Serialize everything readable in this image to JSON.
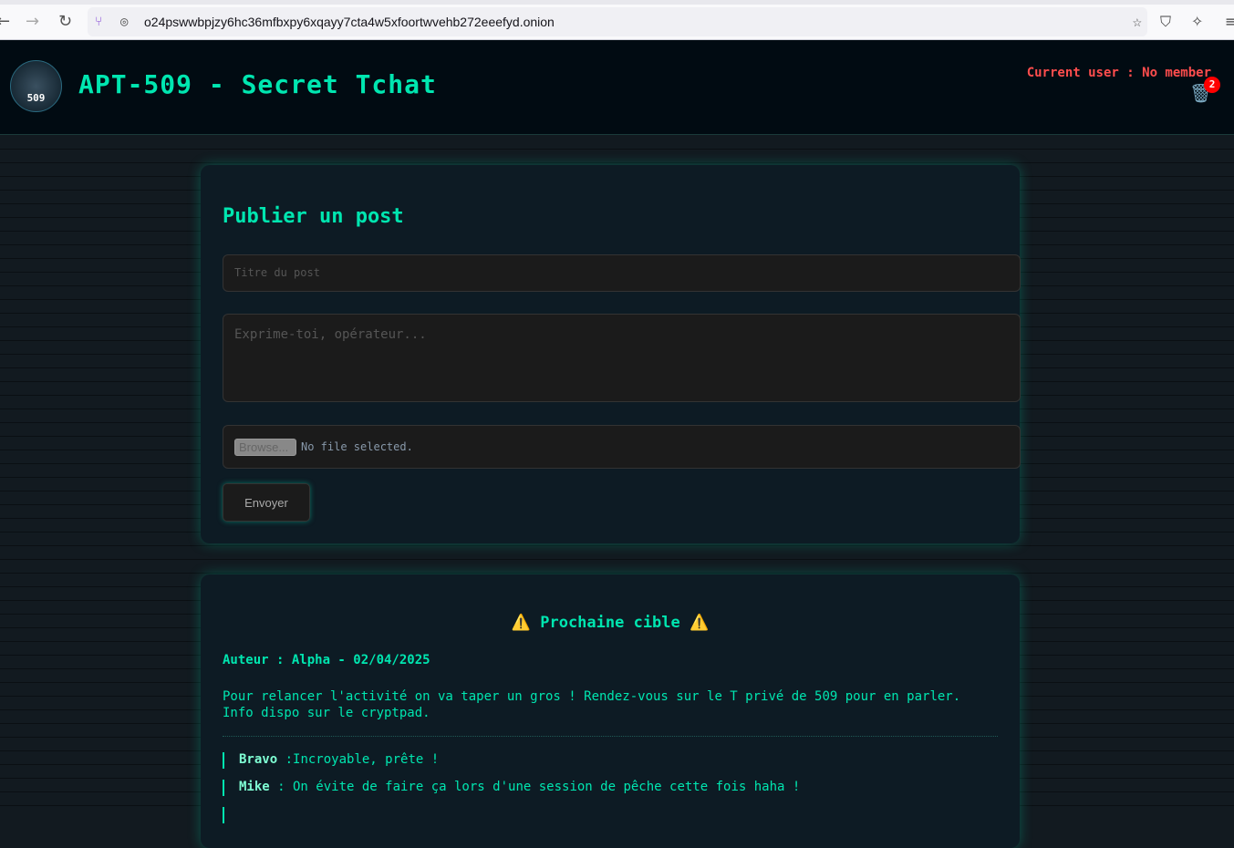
{
  "browser": {
    "url": "o24pswwbpjzy6hc36mfbxpy6xqayy7cta4w5xfoortwvehb272eeefyd.onion"
  },
  "header": {
    "logo_text": "509",
    "title": "APT-509 - Secret Tchat",
    "current_user": "Current user : No member",
    "trash_count": "2"
  },
  "form": {
    "heading": "Publier un post",
    "title_placeholder": "Titre du post",
    "body_placeholder": "Exprime-toi, opérateur...",
    "browse_label": "Browse...",
    "file_status": "No file selected.",
    "submit_label": "Envoyer"
  },
  "post": {
    "title": "Prochaine cible",
    "warning_icon": "⚠️",
    "author": "Auteur : Alpha - 02/04/2025",
    "body": "Pour relancer l'activité on va taper un gros ! Rendez-vous sur le T privé de 509 pour en parler. Info dispo sur le cryptpad.",
    "comments": [
      {
        "author": "Bravo",
        "text": " :Incroyable, prête !"
      },
      {
        "author": "Mike",
        "text": " : On évite de faire ça lors d'une session de pêche cette fois haha !"
      }
    ]
  }
}
